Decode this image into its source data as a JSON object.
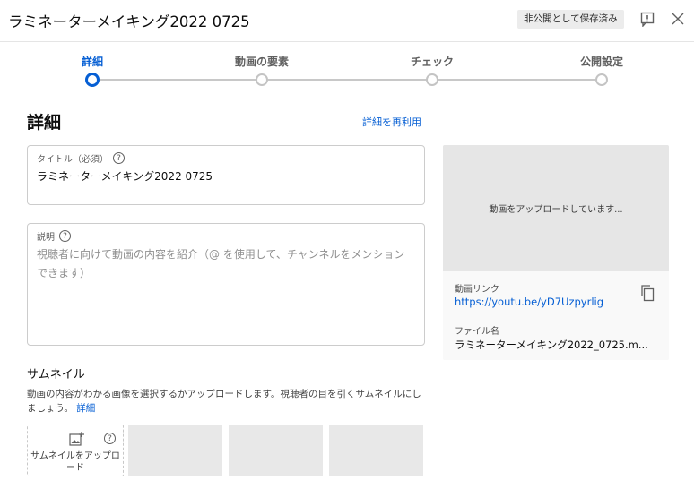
{
  "header": {
    "title": "ラミネーターメイキング2022 0725",
    "save_status": "非公開として保存済み"
  },
  "stepper": {
    "steps": [
      {
        "label": "詳細",
        "active": true
      },
      {
        "label": "動画の要素",
        "active": false
      },
      {
        "label": "チェック",
        "active": false
      },
      {
        "label": "公開設定",
        "active": false
      }
    ]
  },
  "details": {
    "section_title": "詳細",
    "reuse_link": "詳細を再利用",
    "title_field": {
      "label": "タイトル（必須）",
      "value": "ラミネーターメイキング2022 0725"
    },
    "description_field": {
      "label": "説明",
      "placeholder": "視聴者に向けて動画の内容を紹介（@ を使用して、チャンネルをメンションできます）"
    }
  },
  "preview": {
    "status": "動画をアップロードしています...",
    "link_label": "動画リンク",
    "link": "https://youtu.be/yD7Uzpyrlig",
    "filename_label": "ファイル名",
    "filename": "ラミネーターメイキング2022_0725.m..."
  },
  "thumbnail": {
    "title": "サムネイル",
    "description": "動画の内容がわかる画像を選択するかアップロードします。視聴者の目を引くサムネイルにしましょう。",
    "more_link": "詳細",
    "upload_label": "サムネイルをアップロード"
  },
  "icons": {
    "help": "?",
    "feedback": "feedback-icon",
    "close": "close-icon",
    "copy": "copy-icon",
    "upload_image": "add-photo-icon"
  },
  "colors": {
    "accent": "#065fd4",
    "step_inactive": "#c4c4c4",
    "save_badge_bg": "#ececec"
  }
}
